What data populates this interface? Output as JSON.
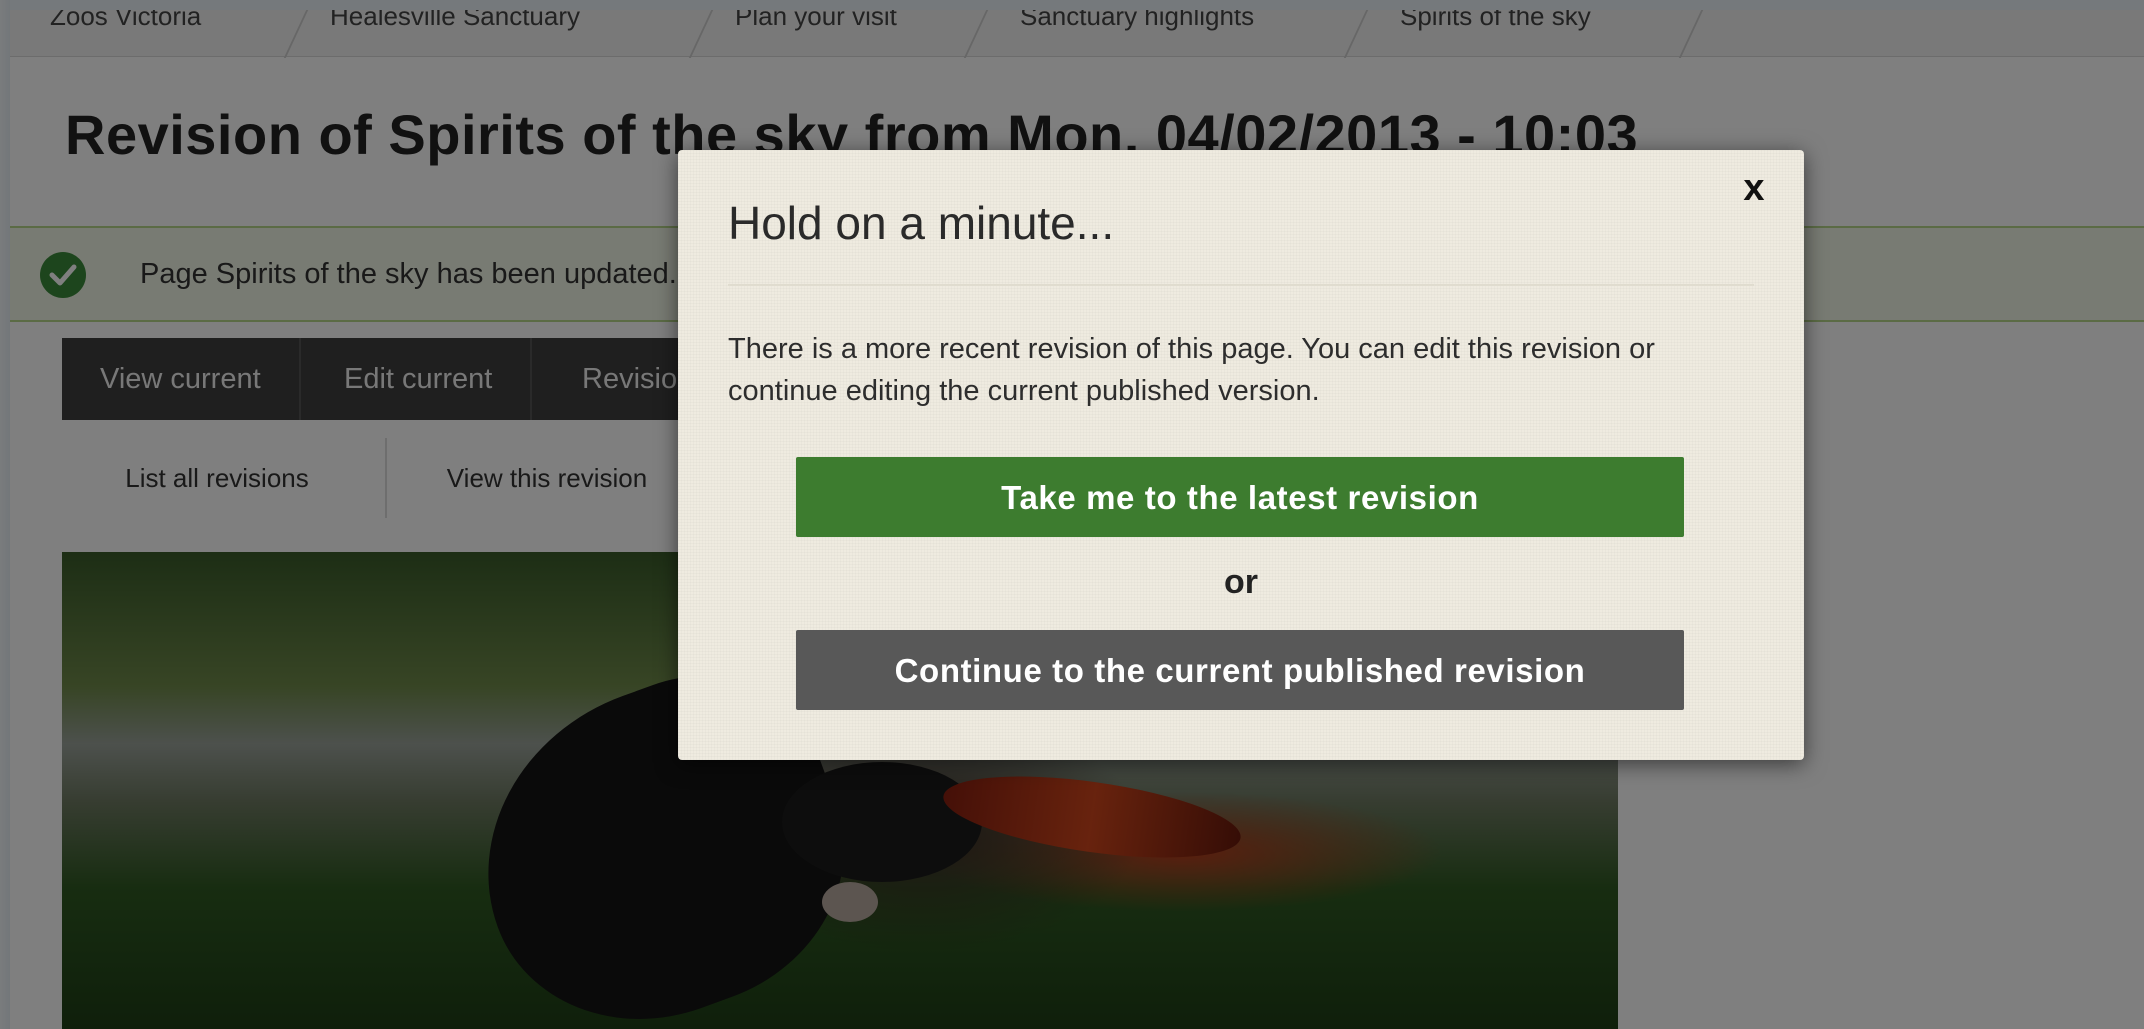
{
  "breadcrumb": {
    "items": [
      {
        "label": "Zoos Victoria"
      },
      {
        "label": "Healesville Sanctuary"
      },
      {
        "label": "Plan your visit"
      },
      {
        "label": "Sanctuary highlights"
      },
      {
        "label": "Spirits of the sky"
      }
    ]
  },
  "page": {
    "title": "Revision of Spirits of the sky from Mon, 04/02/2013 - 10:03"
  },
  "status": {
    "message": "Page Spirits of the sky has been updated."
  },
  "primary_tabs": [
    {
      "label": "View current"
    },
    {
      "label": "Edit current"
    },
    {
      "label": "Revisions"
    }
  ],
  "secondary_tabs": [
    {
      "label": "List all revisions"
    },
    {
      "label": "View this revision"
    }
  ],
  "modal": {
    "title": "Hold on a minute...",
    "close_label": "x",
    "body": "There is a more recent revision of this page. You can edit this revision or continue editing the current published version.",
    "latest_button": "Take me to the latest revision",
    "or_text": "or",
    "continue_button": "Continue to the current published revision"
  },
  "colors": {
    "primary_green": "#3d7c2f",
    "button_gray": "#585858",
    "modal_bg": "#efebe0",
    "overlay": "rgba(0,0,0,0.5)"
  }
}
